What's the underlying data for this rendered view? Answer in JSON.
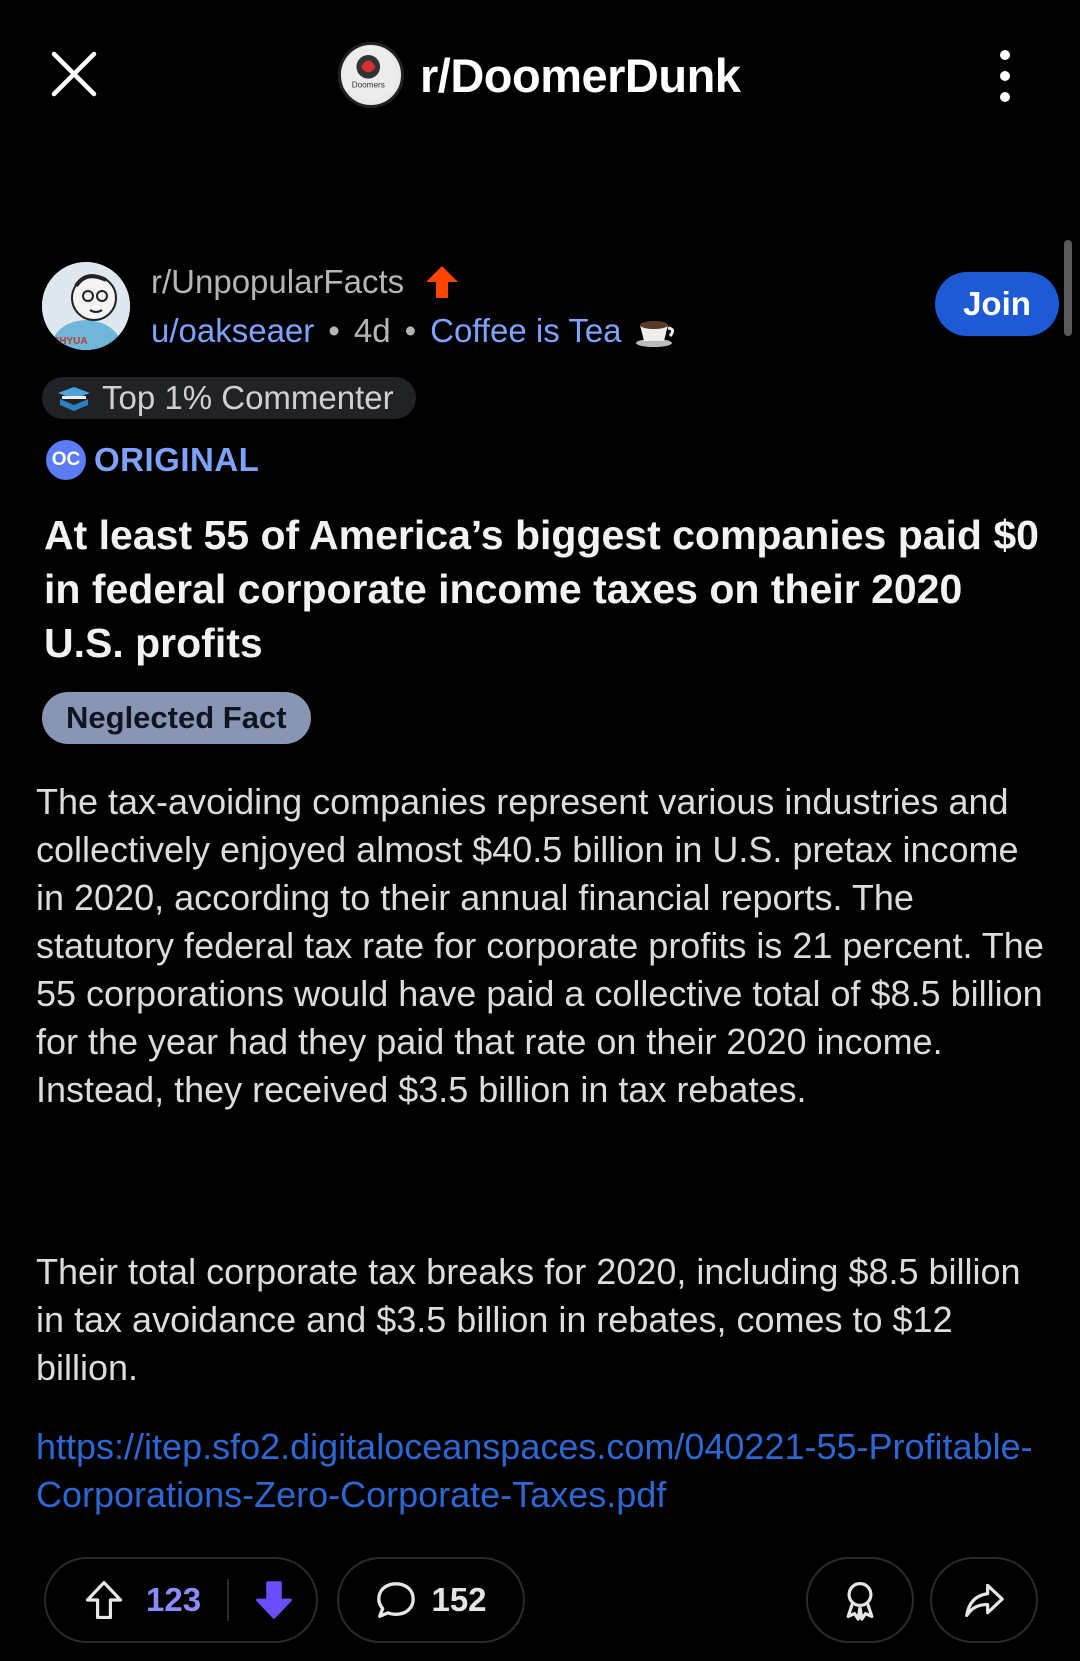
{
  "header": {
    "subreddit": "r/DoomerDunk",
    "avatar_text": "Doomers"
  },
  "post": {
    "community": "r/UnpopularFacts",
    "author": "u/oakseaer",
    "age": "4d",
    "separator": "•",
    "user_flair": "Coffee is Tea",
    "join_label": "Join",
    "avatar_text": "CHYUA",
    "achievement": "Top 1% Commenter",
    "oc_badge": "OC",
    "oc_label": "ORIGINAL",
    "title": "At least 55 of America’s biggest companies paid $0 in federal corporate income taxes on their 2020 U.S. profits",
    "flair": "Neglected Fact",
    "body": [
      "The tax-avoiding companies represent various industries and collectively enjoyed almost $40.5 billion in U.S. pretax income in 2020, according to their annual financial reports. The statutory federal tax rate for corporate profits is 21 percent. The 55 corporations would have paid a collective total of $8.5 billion for the year had they paid that rate on their 2020 income. Instead, they received $3.5 billion in tax rebates.",
      "Their total corporate tax breaks for 2020, including $8.5 billion in tax avoidance and $3.5 billion in rebates, comes to $12 billion."
    ],
    "link": "https://itep.sfo2.digitaloceanspaces.com/040221-55-Profitable-Corporations-Zero-Corporate-Taxes.pdf"
  },
  "actions": {
    "votes": "123",
    "comments": "152"
  },
  "icons": {
    "close": "close-icon",
    "more": "more-vertical-icon",
    "upvote": "upvote-icon",
    "downvote": "downvote-icon",
    "comment": "comment-bubble-icon",
    "award": "award-icon",
    "share": "share-icon",
    "trending": "trending-arrow-icon",
    "coffee": "coffee-cup-icon"
  },
  "colors": {
    "background": "#000000",
    "link_blue": "#2e67d1",
    "accent_blue": "#7fa2ff",
    "join_blue": "#1d5ad3",
    "upvote_purple": "#8c8dfc",
    "downvote_purple": "#6b4dff",
    "trend_orange": "#ff4500",
    "flair_bg": "#8896b4"
  }
}
